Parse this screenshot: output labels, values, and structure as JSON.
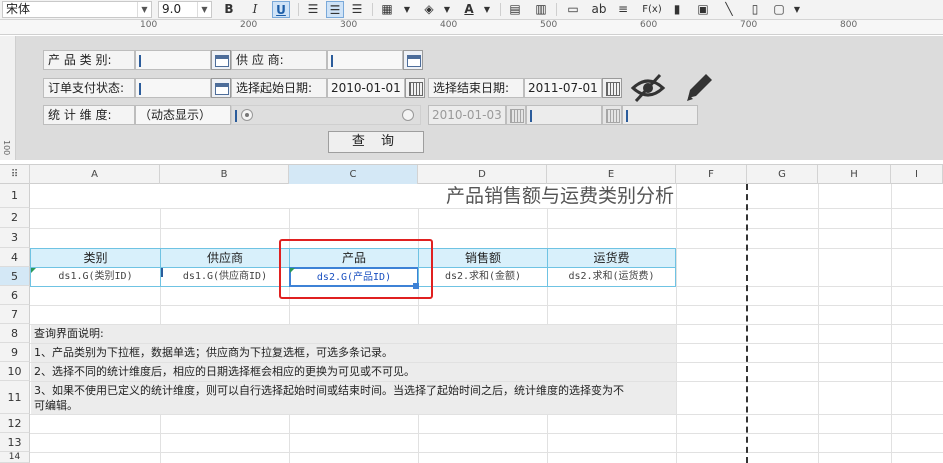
{
  "toolbar": {
    "font_name": "宋体",
    "font_size": "9.0",
    "bold": "B",
    "italic": "I",
    "underline": "U",
    "text_ab": "ab",
    "formula": "F(x)"
  },
  "ruler": {
    "marks": [
      "100",
      "200",
      "300",
      "400",
      "500",
      "600",
      "700",
      "800"
    ],
    "vmark": "100"
  },
  "params": {
    "category_label": "产 品 类 别:",
    "supplier_label": "供 应 商:",
    "payment_status_label": "订单支付状态:",
    "ship_start_label": "选择起始日期:",
    "ship_start_value": "2010-01-01",
    "ship_end_label": "选择结束日期:",
    "ship_end_value": "2011-07-01",
    "dimension_label": "统 计 维 度:",
    "dimension_value": "（动态显示）",
    "disabled_start_value": "2010-01-03",
    "query_button": "查 询"
  },
  "grid": {
    "columns": [
      "A",
      "B",
      "C",
      "D",
      "E",
      "F",
      "G",
      "H",
      "I"
    ],
    "rows": [
      "1",
      "2",
      "3",
      "4",
      "5",
      "6",
      "7",
      "8",
      "9",
      "10",
      "11",
      "12",
      "13",
      "14"
    ],
    "title": "产品销售额与运费类别分析",
    "headers": [
      "类别",
      "供应商",
      "产品",
      "销售额",
      "运货费"
    ],
    "data": [
      "ds1.G(类别ID)",
      "ds1.G(供应商ID)",
      "ds2.G(产品ID)",
      "ds2.求和(金额)",
      "ds2.求和(运货费)"
    ],
    "notes": [
      "查询界面说明:",
      "1、产品类别为下拉框，数据单选；供应商为下拉复选框，可选多条记录。",
      "2、选择不同的统计维度后，相应的日期选择框会相应的更换为可见或不可见。",
      "3、如果不使用已定义的统计维度，则可以自行选择起始时间或结束时间。当选择了起始时间之后，统计维度的选择变为不",
      "可编辑。"
    ]
  },
  "colors": {
    "accent": "#2f7fd0",
    "header_fill": "#d8f0fb",
    "cell_border": "#6fc3e3",
    "highlight_box": "#e02020"
  }
}
